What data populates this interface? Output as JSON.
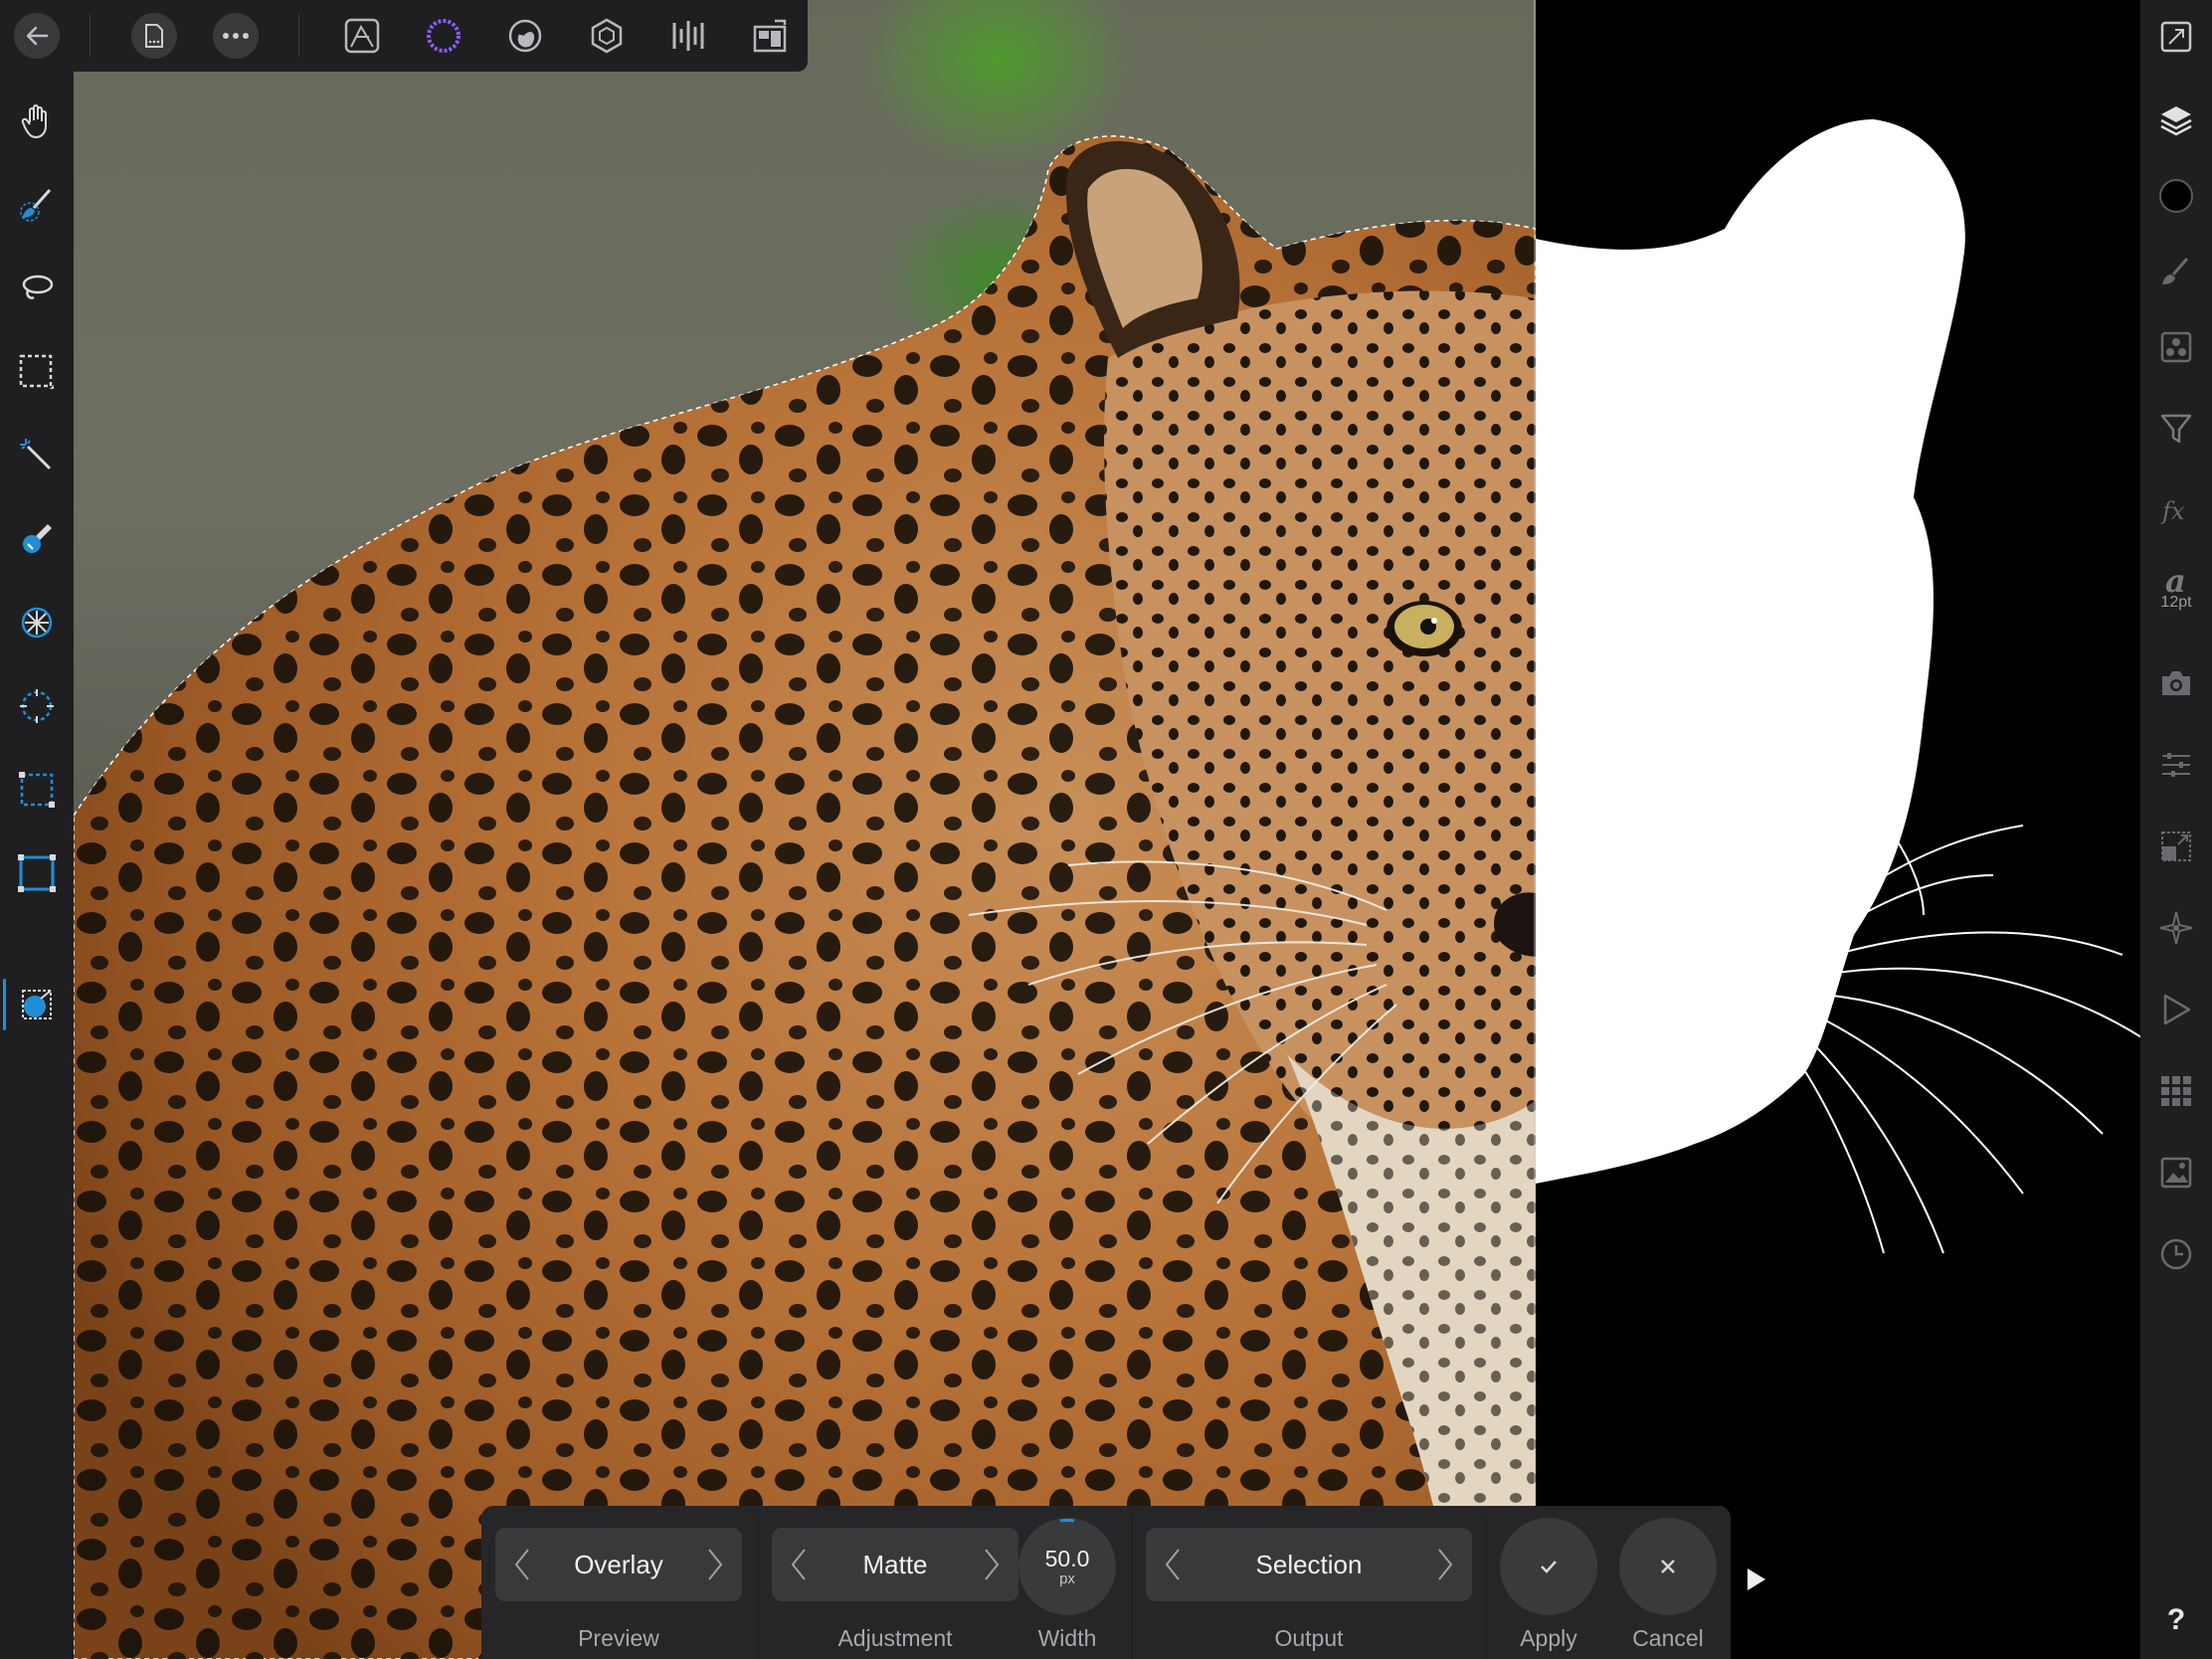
{
  "toolbar_top": {
    "back": "back-icon",
    "document": "document-icon",
    "more": "more-icon",
    "personas": [
      "photo-persona-icon",
      "selection-persona-icon",
      "liquify-persona-icon",
      "develop-persona-icon",
      "tone-mapping-persona-icon",
      "export-persona-icon"
    ],
    "active_persona": "selection-persona-icon"
  },
  "tools_left": [
    "hand-tool",
    "selection-brush-tool",
    "freehand-selection-tool",
    "marquee-selection-tool",
    "flood-select-tool",
    "color-selection-tool",
    "radial-selection-tool",
    "ellipse-selection-tool",
    "rectangle-selection-tool",
    "rectangle-marquee-tool",
    "refine-selection-tool"
  ],
  "active_tool": "refine-selection-tool",
  "studio_right": {
    "items": [
      "navigator",
      "layers",
      "colour",
      "brushes",
      "adjustments",
      "filters",
      "effects",
      "text-styles",
      "stock",
      "transform",
      "snapping",
      "macros",
      "swatches",
      "images",
      "history",
      "help"
    ],
    "font_size_label": "12pt",
    "help_label": "?"
  },
  "context_toolbar": {
    "preview": {
      "value": "Overlay",
      "caption": "Preview"
    },
    "adjustment": {
      "value": "Matte",
      "caption": "Adjustment"
    },
    "width": {
      "value": "50.0",
      "unit": "px",
      "caption": "Width"
    },
    "output": {
      "value": "Selection",
      "caption": "Output"
    },
    "apply": {
      "caption": "Apply"
    },
    "cancel": {
      "caption": "Cancel"
    }
  },
  "colors": {
    "accent": "#1e8fd6",
    "persona_active": "#8b5cf6",
    "panel_bg": "#1f1f21",
    "control_bg": "#39393c",
    "mask_white": "#ffffff",
    "mask_black": "#000000"
  }
}
